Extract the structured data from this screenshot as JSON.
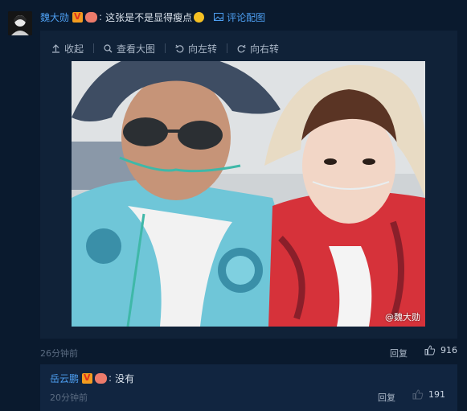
{
  "comment": {
    "username": "魏大勋",
    "text": "这张是不是显得瘦点",
    "view_pic_label": "评论配图",
    "timestamp": "26分钟前",
    "reply_label": "回复",
    "likes": "916"
  },
  "image_toolbar": {
    "collapse": "收起",
    "view_large": "查看大图",
    "rotate_left": "向左转",
    "rotate_right": "向右转"
  },
  "photo": {
    "watermark": "@魏大勋"
  },
  "reply": {
    "username": "岳云鹏",
    "text": "没有",
    "timestamp": "20分钟前",
    "reply_label": "回复",
    "likes": "191"
  },
  "colors": {
    "background": "#0a1a2e",
    "panel": "#102238",
    "link": "#4d9ef0",
    "muted": "#5b6c82"
  }
}
